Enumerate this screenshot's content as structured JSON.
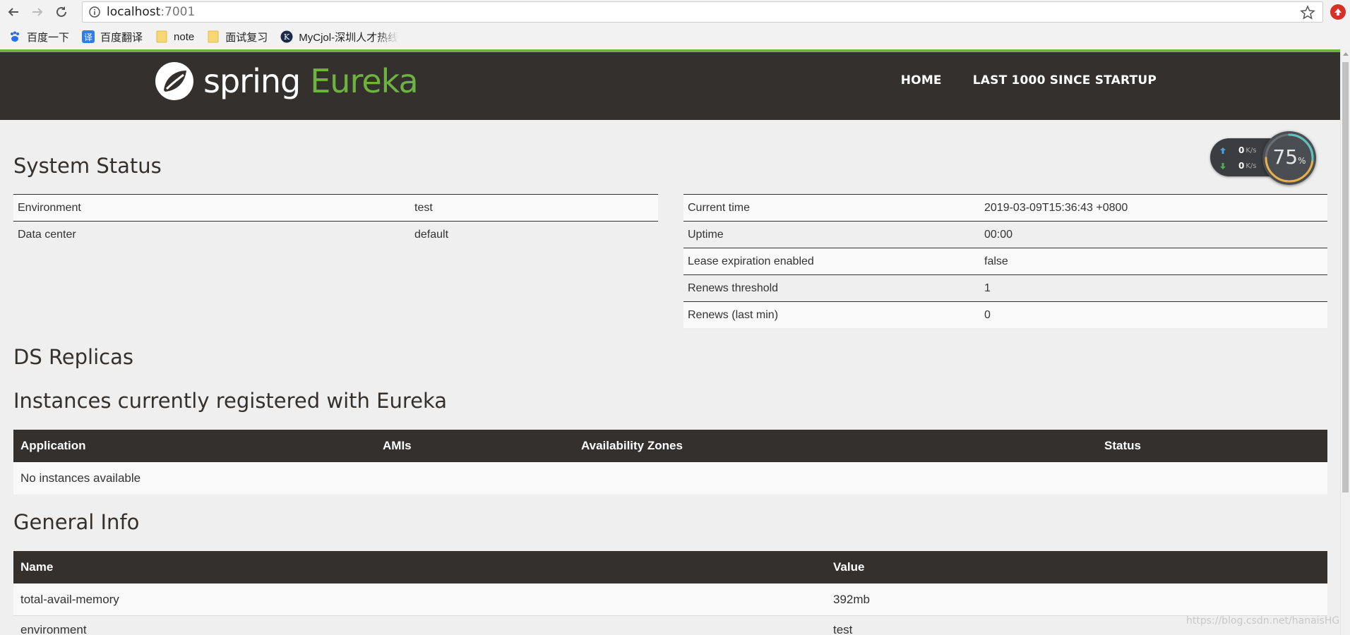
{
  "browser": {
    "url_host": "localhost",
    "url_port": ":7001",
    "bookmarks": [
      {
        "label": "百度一下",
        "icon": "paw-icon"
      },
      {
        "label": "百度翻译",
        "icon": "translate-icon"
      },
      {
        "label": "note",
        "icon": "folder-icon"
      },
      {
        "label": "面试复习",
        "icon": "folder-icon"
      },
      {
        "label": "MyCjol-深圳人才热线",
        "icon": "site-icon"
      }
    ]
  },
  "navbar": {
    "brand_spring": "spring",
    "brand_eureka": "Eureka",
    "links": [
      "HOME",
      "LAST 1000 SINCE STARTUP"
    ]
  },
  "widget": {
    "up_speed": "0",
    "down_speed": "0",
    "unit": "K/s",
    "percent": "75",
    "percent_sign": "%",
    "percent_value": 75
  },
  "system_status": {
    "title": "System Status",
    "left": [
      {
        "key": "Environment",
        "value": "test"
      },
      {
        "key": "Data center",
        "value": "default"
      }
    ],
    "right": [
      {
        "key": "Current time",
        "value": "2019-03-09T15:36:43 +0800"
      },
      {
        "key": "Uptime",
        "value": "00:00"
      },
      {
        "key": "Lease expiration enabled",
        "value": "false"
      },
      {
        "key": "Renews threshold",
        "value": "1"
      },
      {
        "key": "Renews (last min)",
        "value": "0"
      }
    ]
  },
  "ds_replicas": {
    "title": "DS Replicas"
  },
  "instances": {
    "title": "Instances currently registered with Eureka",
    "columns": [
      "Application",
      "AMIs",
      "Availability Zones",
      "Status"
    ],
    "empty_text": "No instances available"
  },
  "general_info": {
    "title": "General Info",
    "columns": [
      "Name",
      "Value"
    ],
    "rows": [
      {
        "name": "total-avail-memory",
        "value": "392mb"
      },
      {
        "name": "environment",
        "value": "test"
      }
    ]
  },
  "watermark": "https://blog.csdn.net/hanaisHG"
}
